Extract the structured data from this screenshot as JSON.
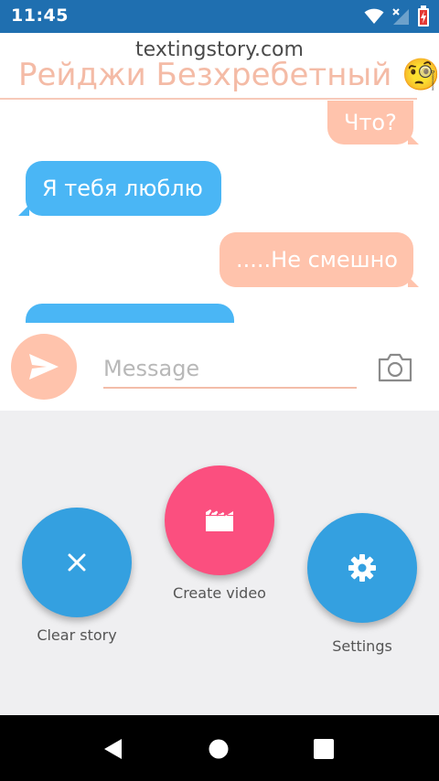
{
  "status_bar": {
    "time": "11:45",
    "background": "#1f6fb0",
    "icons": [
      "wifi-icon",
      "signal-icon",
      "battery-charging-icon"
    ]
  },
  "header": {
    "watermark": "textingstory.com",
    "contact_name": "Рейджи Безхребетный 🧐",
    "name_color": "#f4bba6"
  },
  "messages": [
    {
      "direction": "out",
      "text": "Что?"
    },
    {
      "direction": "in",
      "text": "Я тебя люблю"
    },
    {
      "direction": "out",
      "text": ".....Не смешно"
    },
    {
      "direction": "in",
      "text": ""
    }
  ],
  "input_bar": {
    "placeholder": "Message",
    "value": "",
    "send_icon": "send-icon",
    "camera_icon": "camera-icon"
  },
  "actions": {
    "clear": {
      "label": "Clear story",
      "icon": "close-icon",
      "color": "#34a0e0"
    },
    "create": {
      "label": "Create video",
      "icon": "clapperboard-icon",
      "color": "#fb4f7f"
    },
    "settings": {
      "label": "Settings",
      "icon": "gear-icon",
      "color": "#34a0e0"
    }
  },
  "nav_bar": {
    "buttons": [
      "back-icon",
      "home-icon",
      "recents-icon"
    ]
  },
  "colors": {
    "outgoing_bubble": "#ffc3ac",
    "incoming_bubble": "#4ab6f5"
  }
}
